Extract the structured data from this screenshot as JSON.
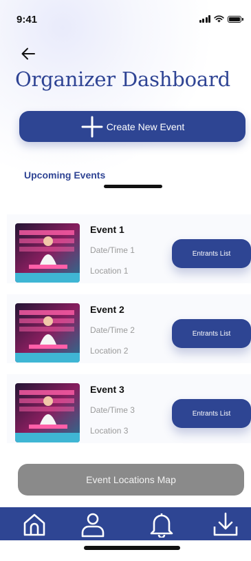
{
  "status_bar": {
    "time": "9:41"
  },
  "header": {
    "title": "Organizer Dashboard"
  },
  "actions": {
    "create_label": "Create New Event",
    "map_label": "Event Locations Map"
  },
  "tabs": {
    "upcoming_label": "Upcoming Events"
  },
  "events": [
    {
      "name": "Event 1",
      "datetime": "Date/Time 1",
      "location": "Location 1",
      "button_label": "Entrants List"
    },
    {
      "name": "Event 2",
      "datetime": "Date/Time 2",
      "location": "Location 2",
      "button_label": "Entrants List"
    },
    {
      "name": "Event 3",
      "datetime": "Date/Time 3",
      "location": "Location 3",
      "button_label": "Entrants List"
    }
  ],
  "nav": {
    "items": [
      {
        "icon": "home-icon"
      },
      {
        "icon": "profile-icon"
      },
      {
        "icon": "bell-icon"
      },
      {
        "icon": "download-icon"
      }
    ]
  },
  "colors": {
    "primary": "#2e4593",
    "title": "#2f4494",
    "disabled": "#8a8a8a",
    "muted_text": "#9a9a9a"
  }
}
